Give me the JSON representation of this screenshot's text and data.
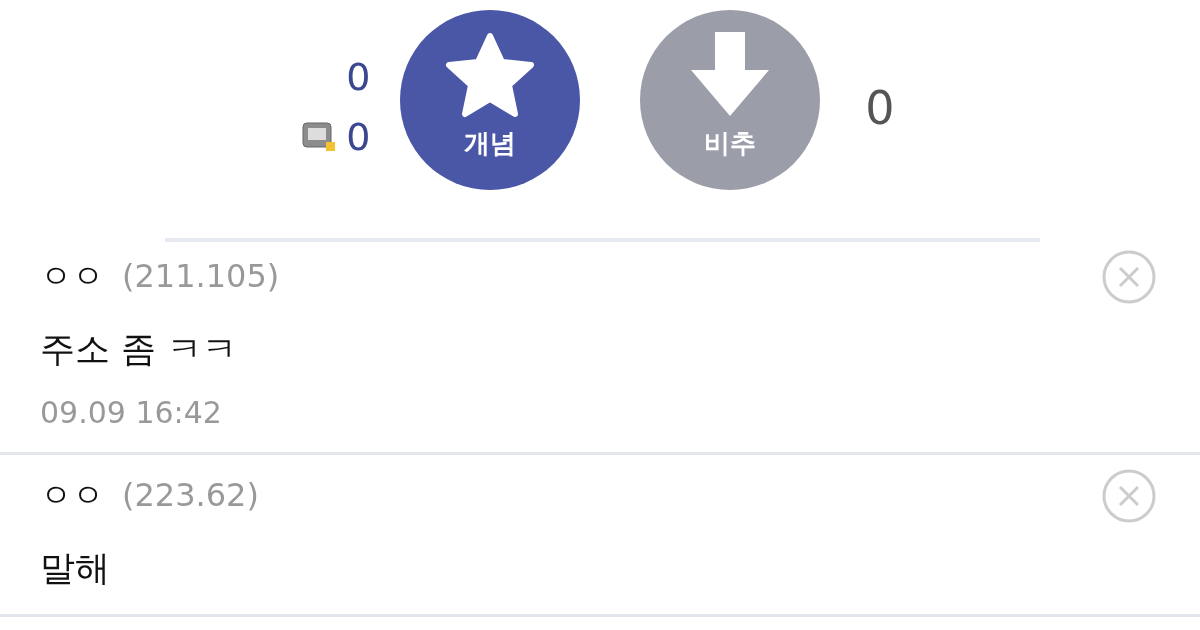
{
  "vote": {
    "recommend_count": "0",
    "mobile_recommend_count": "0",
    "upvote_label": "개념",
    "downvote_label": "비추",
    "downvote_count": "0"
  },
  "comments": [
    {
      "author": "ㅇㅇ",
      "ip": "(211.105)",
      "text": "주소 좀 ㅋㅋ",
      "time": "09.09 16:42"
    },
    {
      "author": "ㅇㅇ",
      "ip": "(223.62)",
      "text": "말해"
    }
  ]
}
